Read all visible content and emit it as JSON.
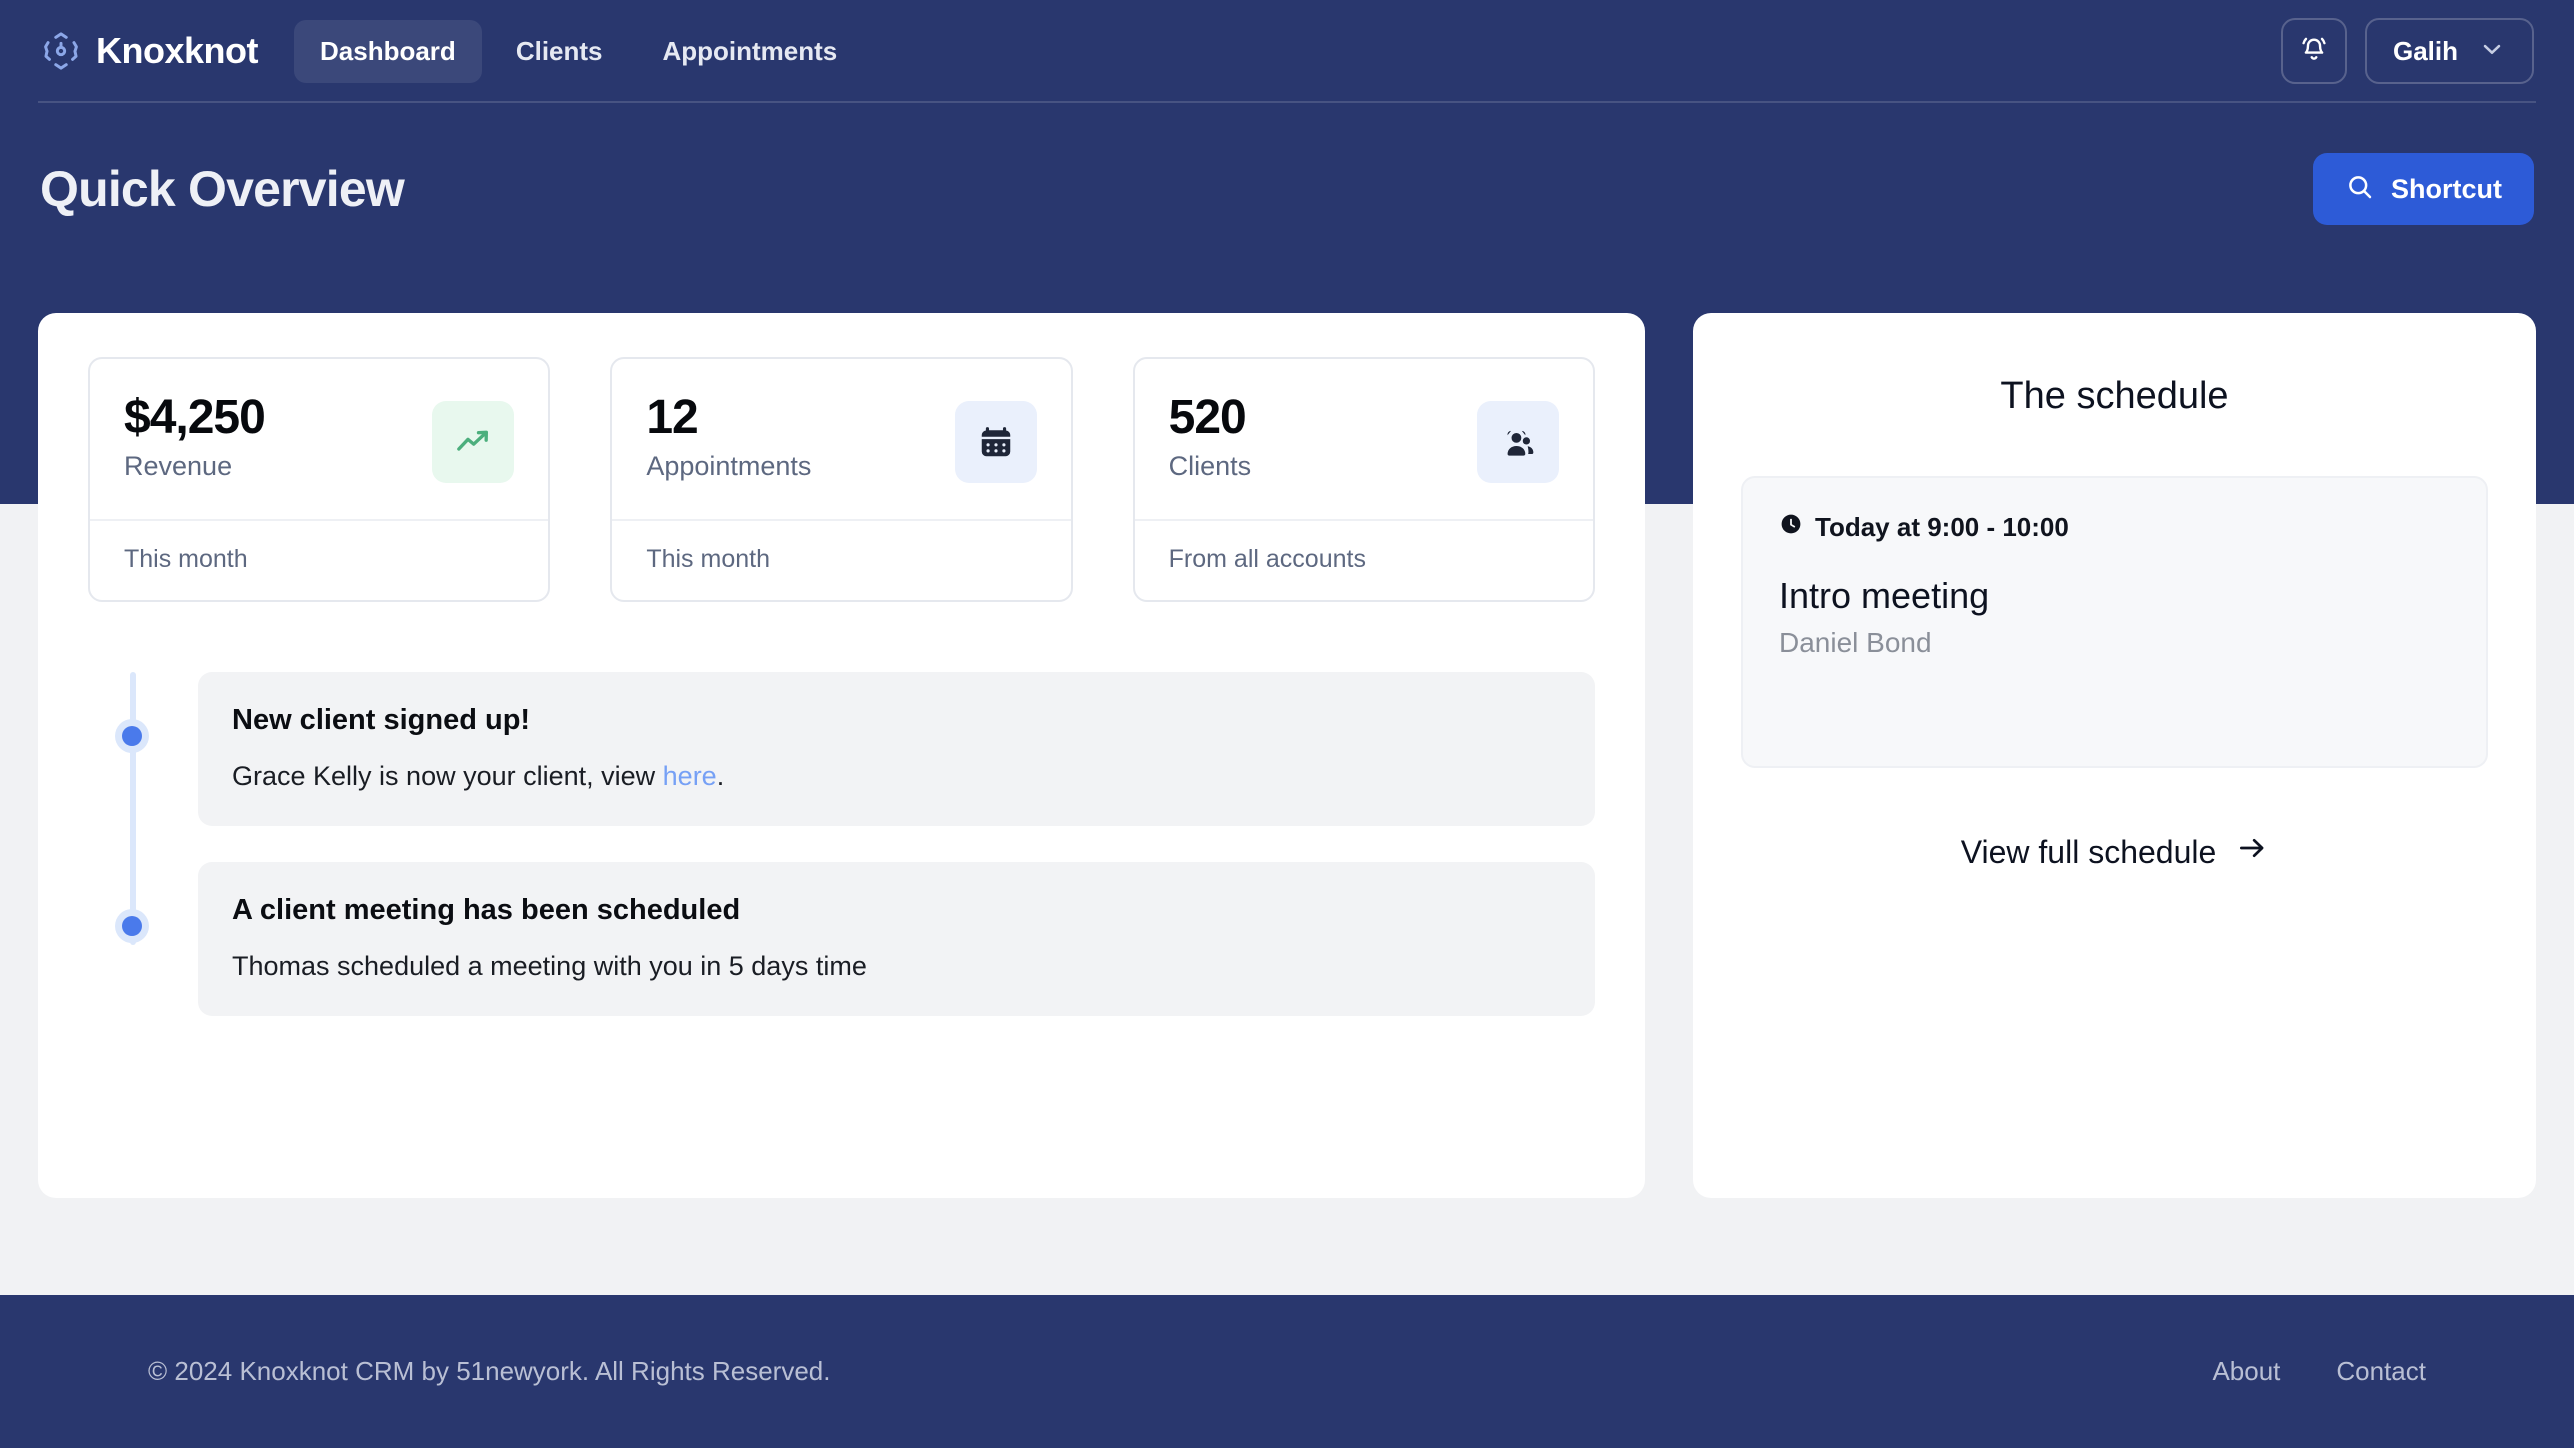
{
  "colors": {
    "navy": "#29376e",
    "nav_active_pill": "#3b487a",
    "accent_blue": "#2d5bd7",
    "link_blue": "#76a0f5",
    "timeline_dot": "#4a7aeb",
    "timeline_rail": "#dbe7fb",
    "green_bg": "#e8f8ee",
    "green_icon": "#4caf7d",
    "blue_bg": "#eaf0fc",
    "page_bg": "#f1f2f4"
  },
  "header": {
    "brand_name": "Knoxknot",
    "brand_logo_icon": "orbit-nodes-icon",
    "nav_items": [
      {
        "label": "Dashboard",
        "active": true
      },
      {
        "label": "Clients",
        "active": false
      },
      {
        "label": "Appointments",
        "active": false
      }
    ],
    "notification_icon": "bell-icon",
    "user_name": "Galih",
    "user_chevron_icon": "chevron-down-icon"
  },
  "hero": {
    "title": "Quick Overview",
    "shortcut_label": "Shortcut",
    "shortcut_icon": "search-icon"
  },
  "stats": [
    {
      "value": "$4,250",
      "label": "Revenue",
      "footer": "This month",
      "icon": "trending-up-icon",
      "icon_style": "green"
    },
    {
      "value": "12",
      "label": "Appointments",
      "footer": "This month",
      "icon": "calendar-icon",
      "icon_style": "blue"
    },
    {
      "value": "520",
      "label": "Clients",
      "footer": "From all accounts",
      "icon": "users-icon",
      "icon_style": "blue"
    }
  ],
  "timeline": [
    {
      "title": "New client signed up!",
      "desc_before": "Grace Kelly is now your client, view ",
      "desc_link": "here",
      "desc_after": "."
    },
    {
      "title": "A client meeting has been scheduled",
      "desc_before": "Thomas scheduled a meeting with you in 5 days time",
      "desc_link": "",
      "desc_after": ""
    }
  ],
  "schedule": {
    "title": "The schedule",
    "clock_icon": "clock-icon",
    "time": "Today at 9:00 - 10:00",
    "event": "Intro meeting",
    "person": "Daniel Bond",
    "link_label": "View full schedule",
    "link_icon": "arrow-right-icon"
  },
  "footer": {
    "copyright": "© 2024 Knoxknot CRM by 51newyork. All Rights Reserved.",
    "links": [
      {
        "label": "About"
      },
      {
        "label": "Contact"
      }
    ]
  }
}
